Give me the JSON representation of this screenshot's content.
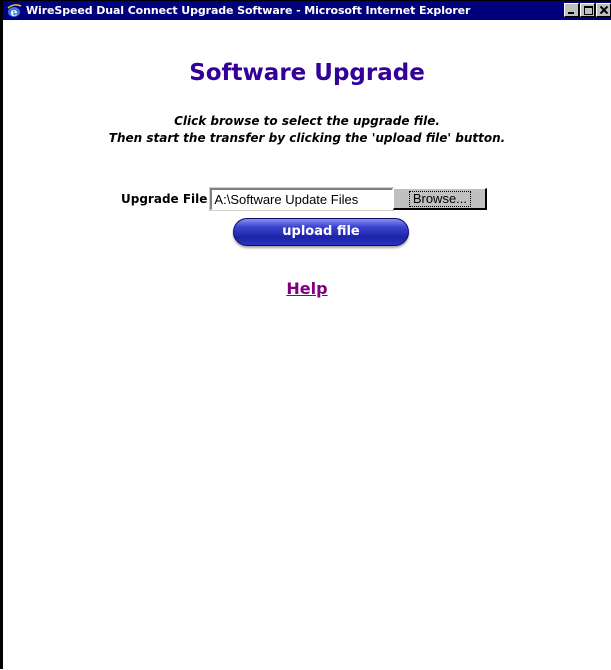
{
  "window": {
    "title": "WireSpeed Dual Connect Upgrade Software - Microsoft Internet Explorer"
  },
  "page": {
    "title": "Software Upgrade",
    "instructions_line1": "Click browse to select the upgrade file.",
    "instructions_line2": "Then start the transfer by clicking the 'upload file' button."
  },
  "form": {
    "upgrade_file_label": "Upgrade File",
    "file_value": "A:\\Software Update Files",
    "browse_label": "Browse...",
    "upload_label": "upload file"
  },
  "links": {
    "help": "Help"
  },
  "colors": {
    "title_bar": "#00007c",
    "page_title": "#330099",
    "help_link": "#800080",
    "upload_button": "#1c23a8"
  },
  "icons": {
    "app_icon": "internet-explorer-icon"
  }
}
